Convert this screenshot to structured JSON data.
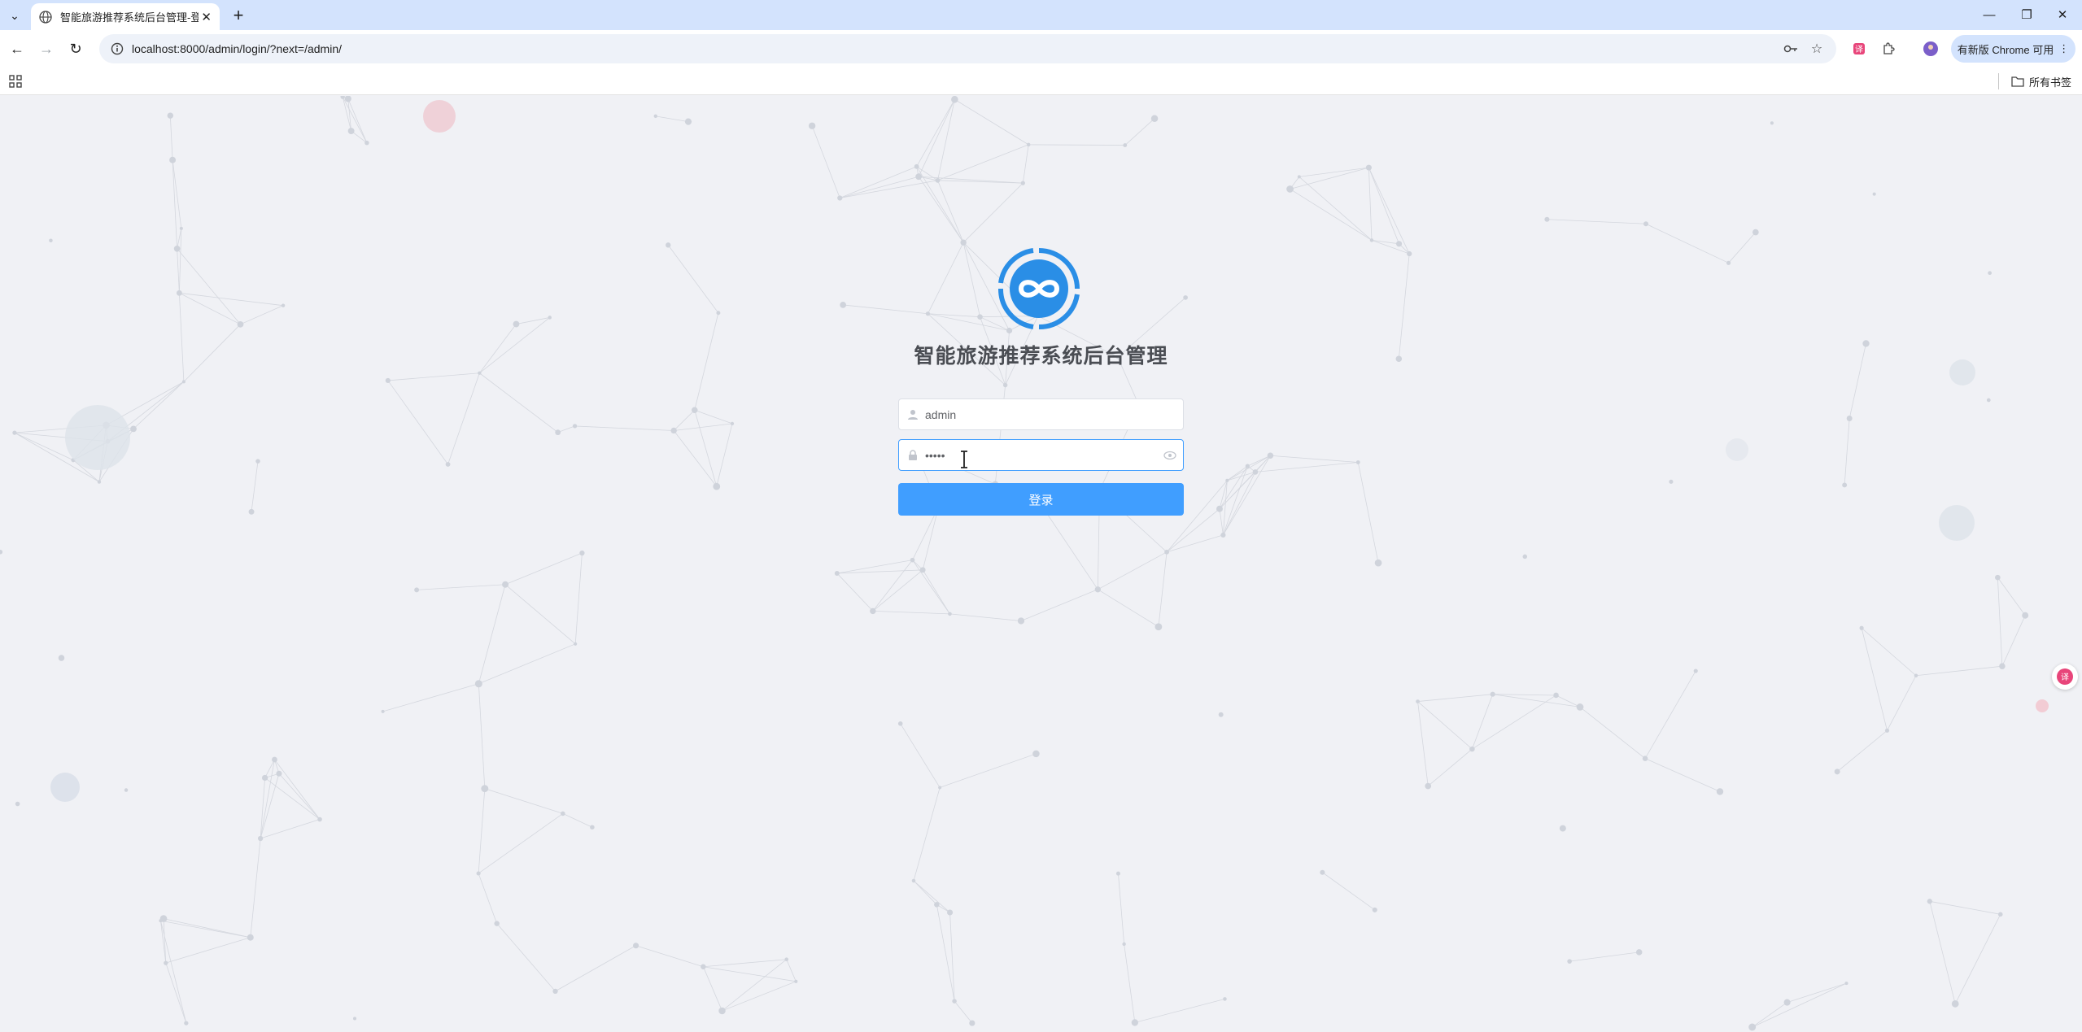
{
  "browser": {
    "tab": {
      "title": "智能旅游推荐系统后台管理-登录"
    },
    "url": "localhost:8000/admin/login/?next=/admin/",
    "update_label": "有新版 Chrome 可用",
    "bookmarks_label": "所有书签"
  },
  "login": {
    "title": "智能旅游推荐系统后台管理",
    "username_value": "admin",
    "password_value": "•••••",
    "submit_label": "登录"
  },
  "colors": {
    "primary": "#409eff",
    "logo": "#2a8ee6",
    "title": "#4a4d53",
    "page_bg": "#f0f1f5"
  }
}
